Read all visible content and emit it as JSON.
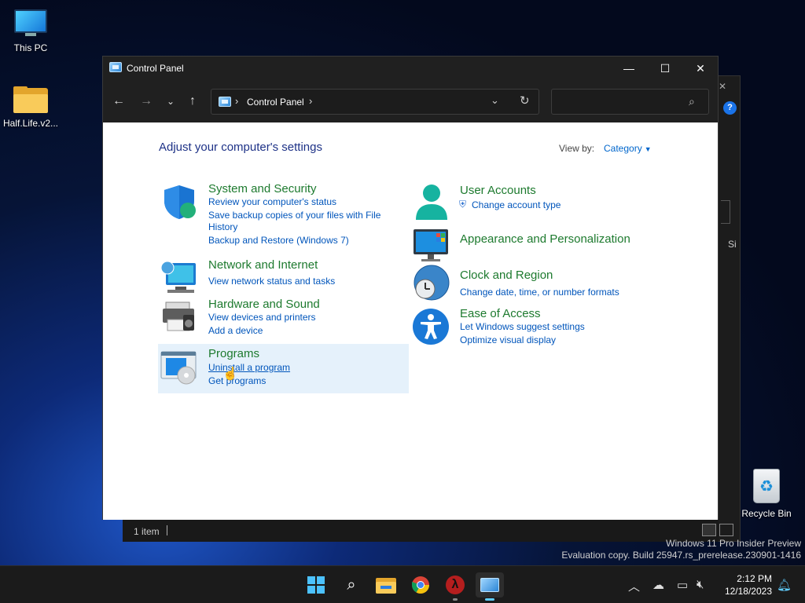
{
  "desktop": {
    "icons": [
      {
        "label": "This PC"
      },
      {
        "label": "Half.Life.v2..."
      },
      {
        "label": "Recycle Bin"
      }
    ]
  },
  "window": {
    "title": "Control Panel",
    "address": {
      "crumb": "Control Panel",
      "sep1": "›",
      "sep2": "›"
    },
    "search": {
      "placeholder": "",
      "value": ""
    },
    "heading": "Adjust your computer's settings",
    "view_by_label": "View by:",
    "view_by_value": "Category",
    "categories_left": [
      {
        "title": "System and Security",
        "icon": "shield-icon",
        "links": [
          "Review your computer's status",
          "Save backup copies of your files with File",
          "History",
          "Backup and Restore (Windows 7)"
        ]
      },
      {
        "title": "Network and Internet",
        "icon": "globe-network-icon",
        "links": [
          "View network status and tasks"
        ]
      },
      {
        "title": "Hardware and Sound",
        "icon": "printer-icon",
        "links": [
          "View devices and printers",
          "Add a device"
        ]
      },
      {
        "title": "Programs",
        "icon": "programs-icon",
        "links": [
          "Uninstall a program",
          "Get programs"
        ]
      }
    ],
    "categories_right": [
      {
        "title": "User Accounts",
        "icon": "user-icon",
        "links": [
          "Change account type"
        ]
      },
      {
        "title": "Appearance and Personalization",
        "icon": "display-icon",
        "links": []
      },
      {
        "title": "Clock and Region",
        "icon": "clock-globe-icon",
        "links": [
          "Change date, time, or number formats"
        ]
      },
      {
        "title": "Ease of Access",
        "icon": "accessibility-icon",
        "links": [
          "Let Windows suggest settings",
          "Optimize visual display"
        ]
      }
    ],
    "status": {
      "count": "1 item"
    }
  },
  "watermark": {
    "line1": "Windows 11 Pro Insider Preview",
    "line2": "Evaluation copy. Build 25947.rs_prerelease.230901-1416"
  },
  "taskbar": {
    "time": "2:12 PM",
    "date": "12/18/2023"
  },
  "colors": {
    "accent": "#0055bb",
    "category_title": "#1d7a2e",
    "heading": "#1e3287",
    "highlight": "#e5f1fb"
  }
}
